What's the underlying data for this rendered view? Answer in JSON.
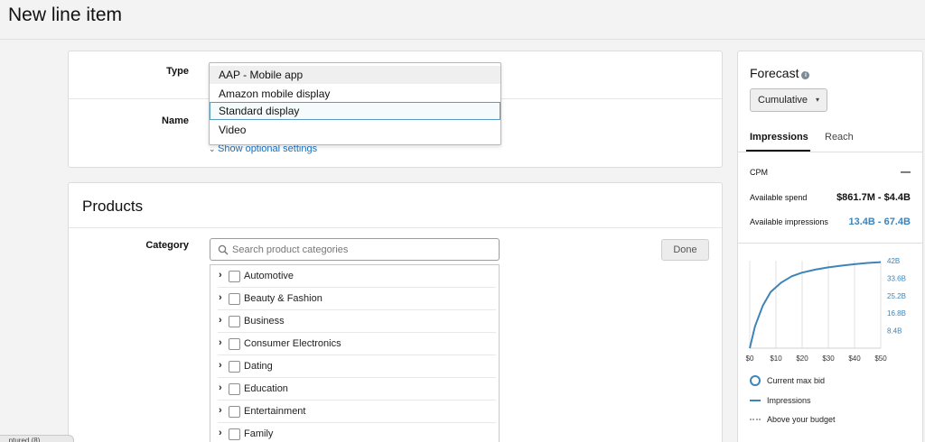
{
  "page": {
    "title": "New line item"
  },
  "details": {
    "type_label": "Type",
    "name_label": "Name",
    "type_options": [
      "AAP - Mobile app",
      "Amazon mobile display",
      "Standard display",
      "Video"
    ],
    "hovered_option_index": 0,
    "selected_option_index": 2,
    "show_optional_label": "Show optional settings"
  },
  "products": {
    "title": "Products",
    "category_label": "Category",
    "search_placeholder": "Search product categories",
    "done_label": "Done",
    "categories": [
      "Automotive",
      "Beauty & Fashion",
      "Business",
      "Consumer Electronics",
      "Dating",
      "Education",
      "Entertainment",
      "Family"
    ]
  },
  "forecast": {
    "title": "Forecast",
    "mode": "Cumulative",
    "tabs": [
      "Impressions",
      "Reach"
    ],
    "active_tab": "Impressions",
    "cpm_label": "CPM",
    "cpm_value": "—",
    "spend_label": "Available spend",
    "spend_value": "$861.7M - $4.4B",
    "impressions_label": "Available impressions",
    "impressions_value": "13.4B - 67.4B",
    "legend": [
      "Current max bid",
      "Impressions",
      "Above your budget"
    ],
    "accent_color": "#3d84b9"
  },
  "chart_data": {
    "type": "line",
    "x_ticks": [
      "$0",
      "$10",
      "$20",
      "$30",
      "$40",
      "$50"
    ],
    "y_ticks": [
      "42B",
      "33.6B",
      "25.2B",
      "16.8B",
      "8.4B"
    ],
    "xlim": [
      0,
      50
    ],
    "ylim": [
      0,
      42
    ],
    "grid": "vertical",
    "series": [
      {
        "name": "Impressions",
        "x": [
          0,
          2,
          5,
          8,
          12,
          16,
          20,
          25,
          30,
          35,
          40,
          45,
          50
        ],
        "y": [
          0,
          10.5,
          20.5,
          27,
          31.5,
          34.5,
          36.3,
          37.7,
          38.8,
          39.6,
          40.3,
          40.9,
          41.3
        ]
      }
    ]
  },
  "footer": {
    "tab_label": "...ptured (8)"
  }
}
